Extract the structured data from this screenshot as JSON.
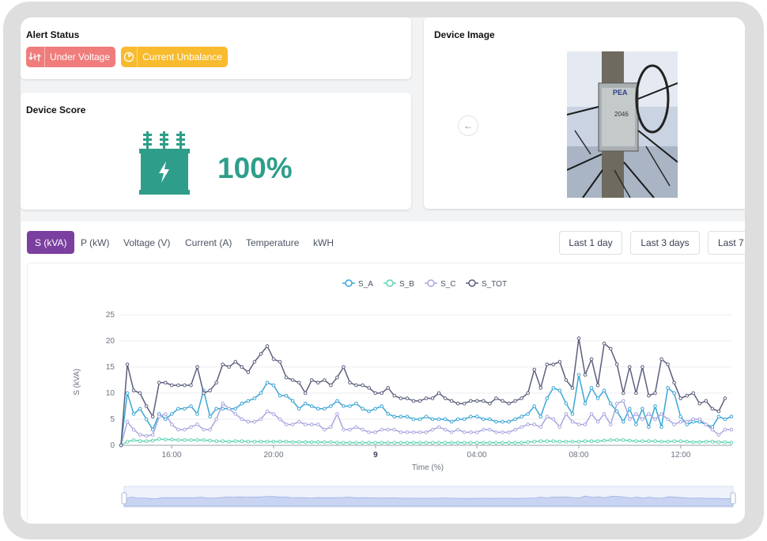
{
  "alert_status": {
    "title": "Alert Status",
    "badges": [
      {
        "label": "Under Voltage",
        "color": "#f07c7c",
        "icon": "voltage-swap-icon"
      },
      {
        "label": "Current Unbalance",
        "color": "#f7bb2d",
        "icon": "gauge-icon"
      }
    ]
  },
  "device_score": {
    "title": "Device Score",
    "value": "100%",
    "icon": "transformer-icon",
    "color": "#2e9e8a"
  },
  "device_image": {
    "title": "Device Image",
    "prev_icon": "arrow-left-icon",
    "photo_text": {
      "brand": "PEA",
      "number": "2046"
    }
  },
  "tabs": [
    {
      "label": "S (kVA)",
      "active": true
    },
    {
      "label": "P (kW)",
      "active": false
    },
    {
      "label": "Voltage (V)",
      "active": false
    },
    {
      "label": "Current (A)",
      "active": false
    },
    {
      "label": "Temperature",
      "active": false
    },
    {
      "label": "kWH",
      "active": false
    }
  ],
  "range_buttons": [
    "Last 1 day",
    "Last 3 days",
    "Last 7"
  ],
  "accent_color": "#7b3fa0",
  "chart_data": {
    "type": "line",
    "title": "",
    "xlabel": "Time (%)",
    "ylabel": "S (kVA)",
    "ylim": [
      0,
      25
    ],
    "yticks": [
      0,
      5,
      10,
      15,
      20,
      25
    ],
    "xticks": [
      "16:00",
      "20:00",
      "9",
      "04:00",
      "08:00",
      "12:00"
    ],
    "legend_position": "top-center",
    "grid": true,
    "series": [
      {
        "name": "S_A",
        "color": "#3ba6d6",
        "values": [
          0,
          10,
          6,
          7,
          5,
          3,
          6,
          5,
          6,
          7,
          7,
          7.5,
          6,
          10.5,
          5.5,
          7,
          7,
          7,
          7,
          8,
          8.5,
          9,
          10,
          12,
          11.5,
          9.5,
          9.5,
          8.5,
          7,
          8,
          7.5,
          7,
          7,
          7.5,
          8.5,
          7.5,
          7.5,
          8,
          7,
          6.5,
          7,
          7.5,
          6,
          5.5,
          5.5,
          5.5,
          5,
          5,
          5.5,
          5,
          5,
          5,
          4.5,
          5,
          5,
          5.5,
          5.5,
          5,
          5,
          4.5,
          4.5,
          4.5,
          5,
          5.5,
          6,
          7.5,
          5.5,
          9,
          11,
          10.5,
          8,
          6,
          13.5,
          8,
          11,
          9,
          10.5,
          8,
          6.5,
          4.5,
          7,
          4,
          7,
          3.5,
          7.5,
          3.5,
          11,
          10,
          5.5,
          4,
          4.5,
          4.5,
          4,
          3.5,
          5.5,
          5,
          5.5
        ]
      },
      {
        "name": "S_B",
        "color": "#5fd3b3",
        "values": [
          0,
          0.7,
          1,
          0.8,
          0.8,
          0.9,
          1.2,
          1.1,
          1.1,
          1,
          1,
          1,
          1,
          1,
          0.9,
          0.8,
          0.8,
          0.7,
          0.8,
          0.8,
          0.7,
          0.7,
          0.7,
          0.7,
          0.7,
          0.7,
          0.7,
          0.6,
          0.6,
          0.6,
          0.6,
          0.6,
          0.6,
          0.6,
          0.5,
          0.5,
          0.5,
          0.5,
          0.5,
          0.5,
          0.5,
          0.5,
          0.5,
          0.5,
          0.5,
          0.5,
          0.5,
          0.5,
          0.5,
          0.5,
          0.5,
          0.5,
          0.5,
          0.5,
          0.5,
          0.5,
          0.5,
          0.5,
          0.5,
          0.5,
          0.5,
          0.5,
          0.5,
          0.5,
          0.6,
          0.7,
          0.8,
          0.8,
          0.8,
          0.7,
          0.7,
          0.7,
          0.7,
          0.8,
          0.8,
          0.8,
          0.9,
          1,
          1,
          1,
          0.9,
          0.8,
          0.8,
          0.8,
          0.8,
          0.7,
          0.7,
          0.8,
          0.8,
          0.7,
          0.6,
          0.6,
          0.7,
          0.7,
          0.6,
          0.6,
          0.5
        ]
      },
      {
        "name": "S_C",
        "color": "#a8a6e0",
        "values": [
          0,
          4.5,
          3,
          2,
          1.8,
          2,
          5.5,
          6,
          4,
          3,
          3,
          3.5,
          4,
          3,
          3,
          5,
          8,
          7,
          6,
          5,
          4.5,
          4.5,
          5,
          6.5,
          6,
          5,
          4,
          4,
          4.5,
          4,
          4,
          4,
          3,
          3.5,
          6,
          3,
          3,
          3.5,
          3,
          2.5,
          2.5,
          3,
          3,
          3,
          2.5,
          2.5,
          2.5,
          2.5,
          2.5,
          3,
          3.5,
          3,
          2.5,
          3,
          2.5,
          2.5,
          2.5,
          3,
          3,
          2.5,
          2.5,
          2.5,
          3,
          3.5,
          4,
          4,
          3.5,
          5.5,
          5,
          3.5,
          6,
          4.5,
          4,
          4,
          6,
          4.5,
          6,
          4,
          8,
          8.5,
          5,
          6,
          5,
          6,
          5,
          6,
          5,
          4,
          4.5,
          4.5,
          5,
          5,
          4,
          3,
          2,
          3,
          3
        ]
      },
      {
        "name": "S_TOT",
        "color": "#5b5f7d",
        "values": [
          0,
          15.5,
          10.5,
          10,
          7.5,
          5.5,
          12,
          12,
          11.5,
          11.5,
          11.5,
          11.5,
          15,
          10,
          10.5,
          12,
          15.5,
          15,
          16,
          15,
          14,
          16,
          17.5,
          19,
          16.5,
          16,
          13,
          12.5,
          12,
          10,
          12.5,
          12,
          12.5,
          11.5,
          13,
          15,
          12,
          11.5,
          11.5,
          11,
          10,
          10,
          11,
          9.5,
          9,
          9,
          8.5,
          8.5,
          9,
          9,
          10,
          9,
          8.5,
          8,
          8,
          8.5,
          8.5,
          8.5,
          8,
          9,
          8.5,
          8,
          8.5,
          9,
          10,
          14.5,
          11,
          15.5,
          15.5,
          16,
          12.5,
          11,
          20.5,
          13.5,
          16.5,
          11.5,
          19.5,
          18.5,
          15.5,
          10,
          15,
          10,
          15,
          9.5,
          10,
          16.5,
          15.5,
          12,
          9,
          9.5,
          10,
          8,
          8.5,
          7,
          6.5,
          9
        ]
      }
    ]
  }
}
